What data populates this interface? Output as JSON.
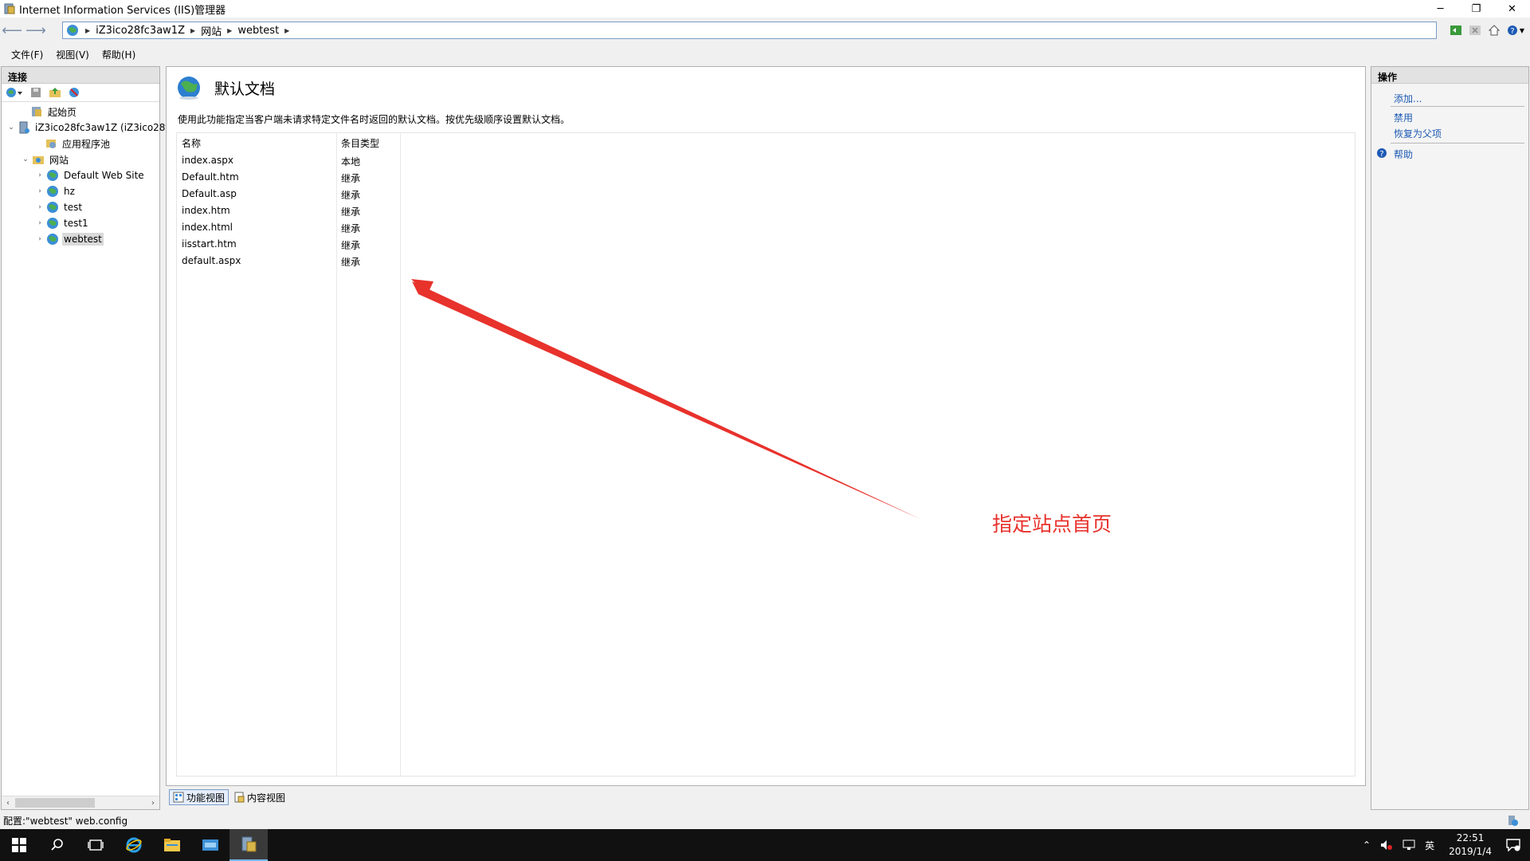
{
  "window": {
    "title": "Internet Information Services (IIS)管理器",
    "controls": {
      "minimize": "─",
      "restore": "❐",
      "close": "✕"
    }
  },
  "address": {
    "crumbs": [
      "iZ3ico28fc3aw1Z",
      "网站",
      "webtest"
    ]
  },
  "menu": {
    "file": "文件(F)",
    "view": "视图(V)",
    "help": "帮助(H)"
  },
  "connections": {
    "header": "连接",
    "tree": [
      {
        "label": "起始页",
        "level": 1,
        "expander": "",
        "icon": "start-page-icon"
      },
      {
        "label": "iZ3ico28fc3aw1Z (iZ3ico28f",
        "level": 0,
        "expander": "⌄",
        "icon": "server-icon"
      },
      {
        "label": "应用程序池",
        "level": 2,
        "expander": "",
        "icon": "app-pool-icon"
      },
      {
        "label": "网站",
        "level": 1,
        "expander": "⌄",
        "icon": "sites-folder-icon"
      },
      {
        "label": "Default Web Site",
        "level": 2,
        "expander": "›",
        "icon": "globe-icon"
      },
      {
        "label": "hz",
        "level": 2,
        "expander": "›",
        "icon": "globe-icon"
      },
      {
        "label": "test",
        "level": 2,
        "expander": "›",
        "icon": "globe-icon"
      },
      {
        "label": "test1",
        "level": 2,
        "expander": "›",
        "icon": "globe-icon"
      },
      {
        "label": "webtest",
        "level": 2,
        "expander": "›",
        "icon": "globe-icon",
        "selected": true
      }
    ]
  },
  "feature": {
    "title": "默认文档",
    "description": "使用此功能指定当客户端未请求特定文件名时返回的默认文档。按优先级顺序设置默认文档。",
    "columns": [
      "名称",
      "条目类型"
    ],
    "rows": [
      {
        "name": "index.aspx",
        "type": "本地"
      },
      {
        "name": "Default.htm",
        "type": "继承"
      },
      {
        "name": "Default.asp",
        "type": "继承"
      },
      {
        "name": "index.htm",
        "type": "继承"
      },
      {
        "name": "index.html",
        "type": "继承"
      },
      {
        "name": "iisstart.htm",
        "type": "继承"
      },
      {
        "name": "default.aspx",
        "type": "继承"
      }
    ]
  },
  "annotation": {
    "text": "指定站点首页",
    "color": "#e8322c"
  },
  "viewtabs": {
    "features": "功能视图",
    "content": "内容视图"
  },
  "actions": {
    "header": "操作",
    "add": "添加...",
    "disable": "禁用",
    "revert": "恢复为父项",
    "help": "帮助"
  },
  "status": {
    "text": "配置:\"webtest\" web.config"
  },
  "taskbar": {
    "time": "22:51",
    "date": "2019/1/4",
    "ime": "英"
  }
}
